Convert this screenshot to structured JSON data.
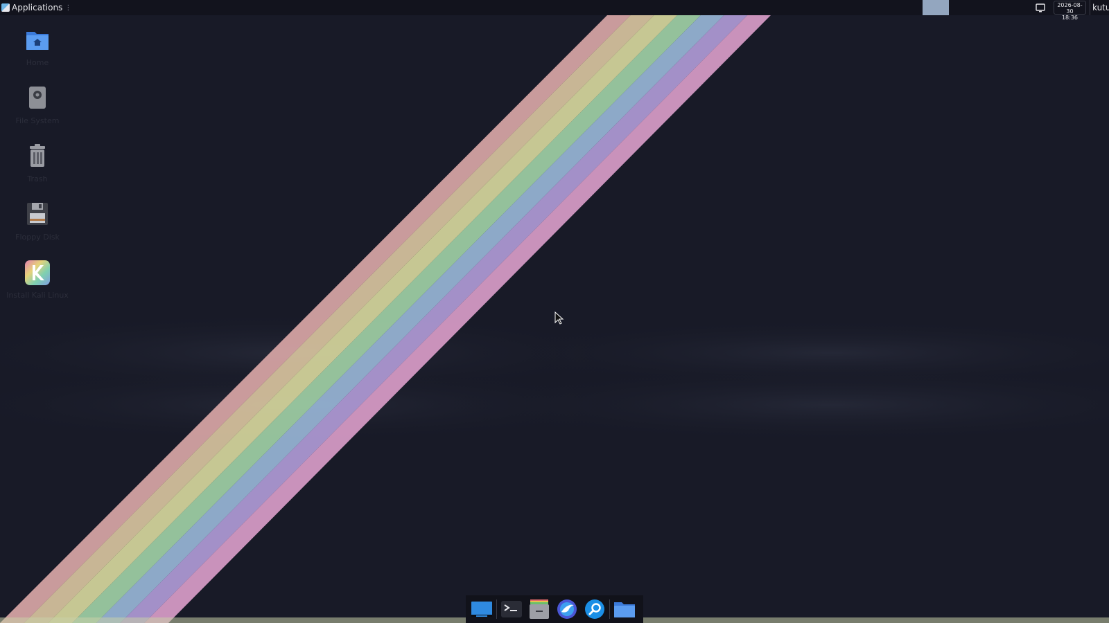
{
  "top_panel": {
    "applications_label": "Applications",
    "clock_date": "2026-08-30",
    "clock_time": "18:36",
    "user_label": "kutu",
    "workspace_color": "#93a6bf"
  },
  "desktop_icons": [
    {
      "label": "Home",
      "icon": "home-folder-icon"
    },
    {
      "label": "File System",
      "icon": "hard-drive-icon"
    },
    {
      "label": "Trash",
      "icon": "trash-icon"
    },
    {
      "label": "Floppy Disk",
      "icon": "floppy-disk-icon"
    },
    {
      "label": "Install Kali Linux",
      "icon": "kali-installer-icon"
    }
  ],
  "dock": [
    {
      "icon": "show-desktop-icon"
    },
    {
      "icon": "terminal-icon"
    },
    {
      "icon": "file-cabinet-icon"
    },
    {
      "icon": "web-browser-icon"
    },
    {
      "icon": "app-finder-icon"
    },
    {
      "icon": "file-manager-icon"
    }
  ],
  "wallpaper": {
    "background": "#181a27",
    "stripes": [
      "#d9a6a6",
      "#d8c39e",
      "#d6d69c",
      "#9fcfa5",
      "#98b5d6",
      "#b09ad6",
      "#d99cc8"
    ]
  }
}
